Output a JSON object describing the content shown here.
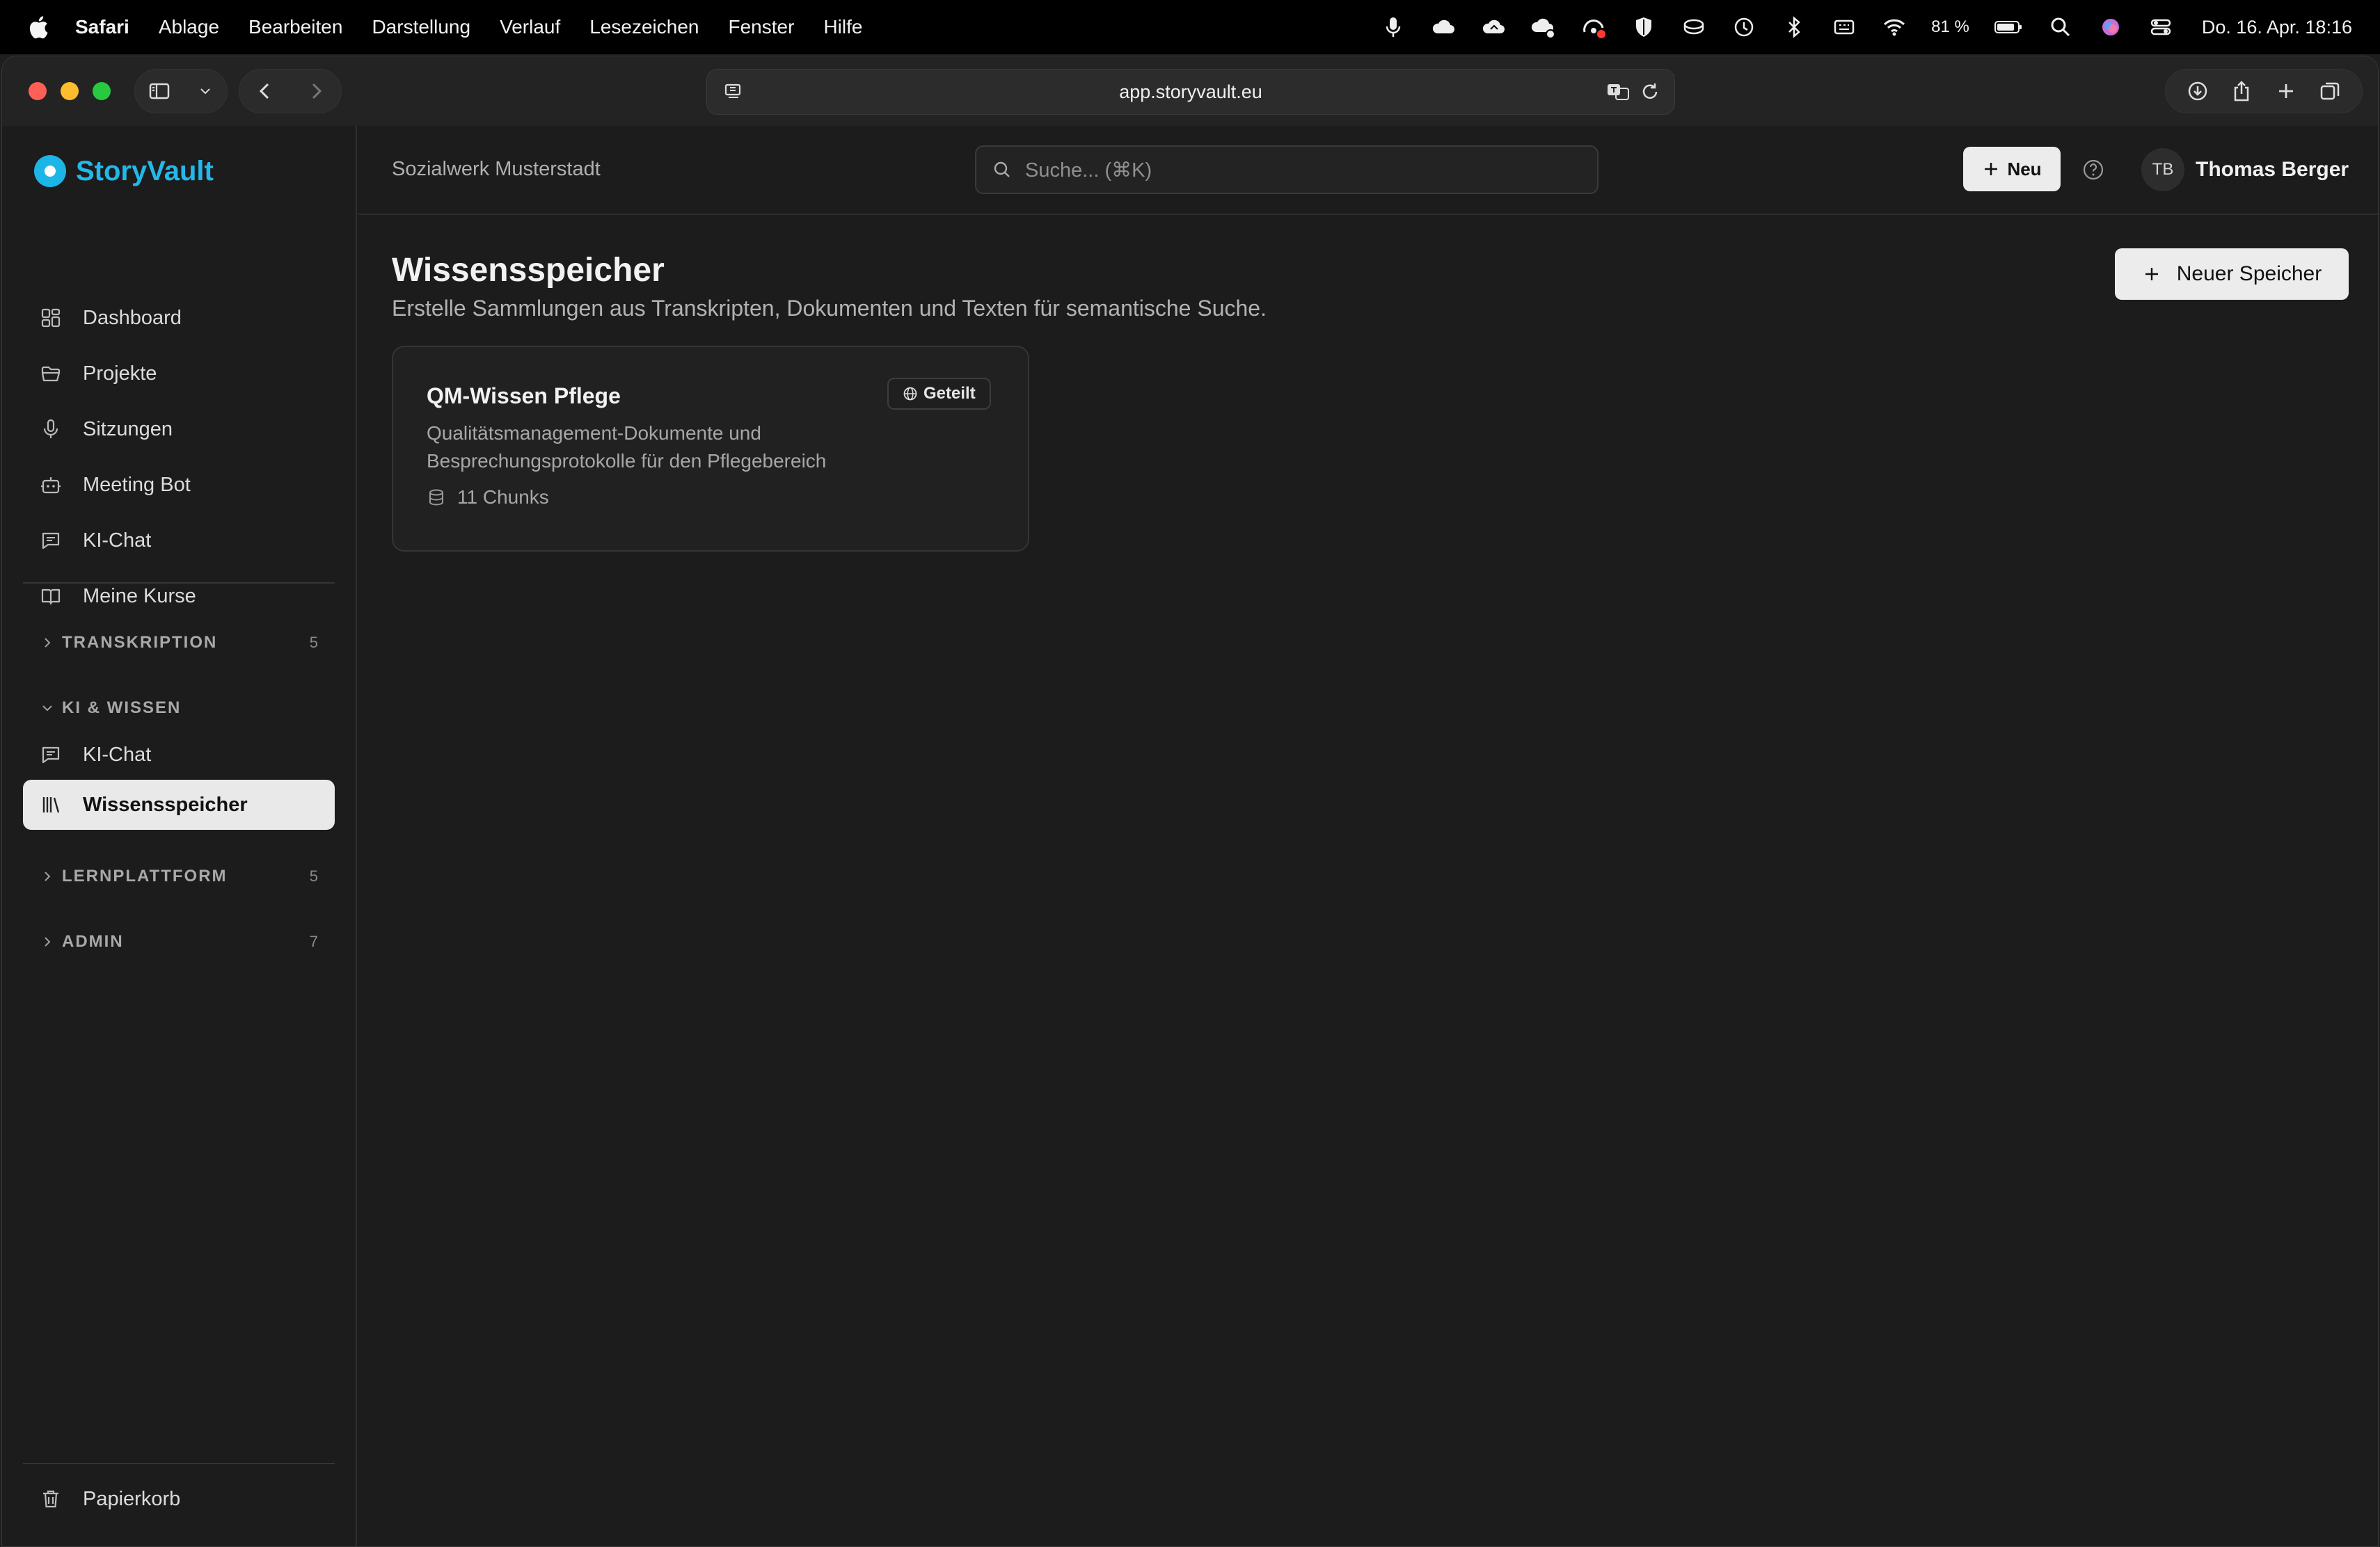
{
  "menubar": {
    "app_name": "Safari",
    "items": [
      "Ablage",
      "Bearbeiten",
      "Darstellung",
      "Verlauf",
      "Lesezeichen",
      "Fenster",
      "Hilfe"
    ],
    "battery": "81 %",
    "clock": "Do. 16. Apr.  18:16"
  },
  "browser": {
    "url": "app.storyvault.eu"
  },
  "app": {
    "logo": "StoryVault",
    "org": "Sozialwerk Musterstadt",
    "search_placeholder": "Suche... (⌘K)",
    "new_button": "Neu",
    "user": {
      "initials": "TB",
      "name": "Thomas Berger"
    }
  },
  "sidebar": {
    "nav": [
      {
        "label": "Dashboard",
        "icon": "dashboard-icon"
      },
      {
        "label": "Projekte",
        "icon": "folder-icon"
      },
      {
        "label": "Sitzungen",
        "icon": "microphone-icon"
      },
      {
        "label": "Meeting Bot",
        "icon": "bot-icon"
      },
      {
        "label": "KI-Chat",
        "icon": "chat-icon"
      },
      {
        "label": "Meine Kurse",
        "icon": "book-icon"
      }
    ],
    "sections": {
      "transkription": {
        "title": "TRANSKRIPTION",
        "count": "5"
      },
      "ki_wissen": {
        "title": "KI & WISSEN",
        "items": [
          {
            "label": "KI-Chat",
            "icon": "chat-icon"
          },
          {
            "label": "Wissensspeicher",
            "icon": "library-icon",
            "active": true
          }
        ]
      },
      "lernplattform": {
        "title": "LERNPLATTFORM",
        "count": "5"
      },
      "admin": {
        "title": "ADMIN",
        "count": "7"
      }
    },
    "trash": "Papierkorb"
  },
  "main": {
    "title": "Wissensspeicher",
    "subtitle": "Erstelle Sammlungen aus Transkripten, Dokumenten und Texten für semantische Suche.",
    "new_store_button": "Neuer Speicher",
    "cards": [
      {
        "title": "QM-Wissen Pflege",
        "badge": "Geteilt",
        "description": "Qualitätsmanagement-Dokumente und Besprechungsprotokolle für den Pflegebereich",
        "meta": "11 Chunks"
      }
    ]
  },
  "colors": {
    "accent": "#24b8ea",
    "background": "#1c1c1c",
    "active_nav_bg": "#e9e9e9"
  }
}
